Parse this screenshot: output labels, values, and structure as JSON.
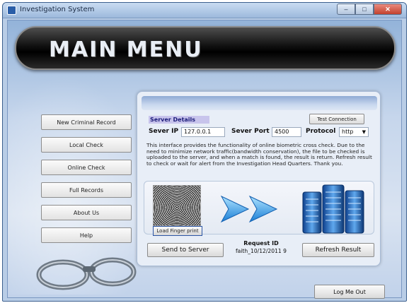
{
  "window": {
    "title": "Investigation System",
    "controls": {
      "minimize": "–",
      "maximize": "□",
      "close": "✕"
    }
  },
  "banner": {
    "heading": "MAIN MENU"
  },
  "sidebar": {
    "items": [
      {
        "label": "New Criminal Record"
      },
      {
        "label": "Local Check"
      },
      {
        "label": "Online Check"
      },
      {
        "label": "Full Records"
      },
      {
        "label": "About Us"
      },
      {
        "label": "Help"
      }
    ]
  },
  "server": {
    "header": "Server Details",
    "test_button": "Test Connection",
    "ip_label": "Sever IP",
    "ip_value": "127.0.0.1",
    "port_label": "Sever Port",
    "port_value": "4500",
    "protocol_label": "Protocol",
    "protocol_value": "http"
  },
  "description": "This interface provides the functionality of online biometric cross check. Due to the need to minimize network traffic(bandwidth conservation), the file to be checked is uploaded to the server, and when a match is found, the result is return. Refresh result to check or wait for alert from the Investigation Head Quarters. Thank you.",
  "load_button": "Load Finger print",
  "actions": {
    "send": "Send to Server",
    "request_label": "Request ID",
    "request_value": "faith_10/12/2011 9",
    "refresh": "Refresh Result"
  },
  "logout": "Log Me Out",
  "colors": {
    "banner": "#000000",
    "accent": "#2a6fd1",
    "background": "#b9cde6"
  }
}
